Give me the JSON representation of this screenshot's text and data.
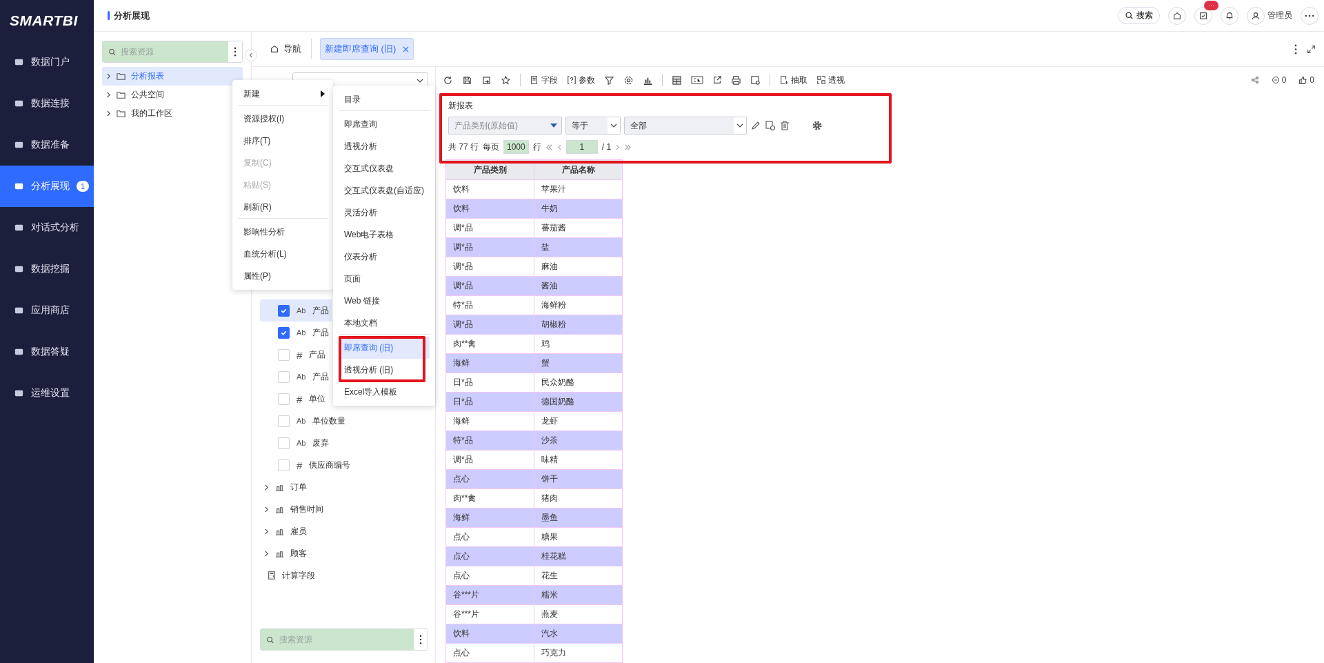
{
  "nav": {
    "logo": "SMARTBI",
    "items": [
      {
        "label": "数据门户",
        "selected": false
      },
      {
        "label": "数据连接",
        "selected": false
      },
      {
        "label": "数据准备",
        "selected": false
      },
      {
        "label": "分析展现",
        "selected": true,
        "badge": "1"
      },
      {
        "label": "对话式分析",
        "selected": false
      },
      {
        "label": "数据挖掘",
        "selected": false
      },
      {
        "label": "应用商店",
        "selected": false
      },
      {
        "label": "数据答疑",
        "selected": false
      },
      {
        "label": "运维设置",
        "selected": false
      }
    ]
  },
  "header": {
    "title": "分析展现",
    "search": "搜索",
    "task_badge": "···",
    "user": "管理员"
  },
  "resources": {
    "search_placeholder": "搜索资源",
    "items": [
      {
        "label": "分析报表",
        "selected": true
      },
      {
        "label": "公共空间",
        "selected": false
      },
      {
        "label": "我的工作区",
        "selected": false
      }
    ]
  },
  "tabs": [
    {
      "label": "导航",
      "selected": false
    },
    {
      "label": "新建即席查询 (旧)",
      "selected": true
    }
  ],
  "fields": {
    "items": [
      {
        "label": "产品",
        "kind": "text",
        "type_mark": "Ab",
        "checked": true,
        "selected": true
      },
      {
        "label": "产品",
        "kind": "text",
        "type_mark": "Ab",
        "checked": true,
        "selected": false
      },
      {
        "label": "产品",
        "kind": "number",
        "type_mark": "#",
        "checked": false,
        "selected": false
      },
      {
        "label": "产品",
        "kind": "text",
        "type_mark": "Ab",
        "checked": false,
        "selected": false
      },
      {
        "label": "单位",
        "kind": "number",
        "type_mark": "#",
        "checked": false,
        "selected": false
      },
      {
        "label": "单位数量",
        "kind": "text",
        "type_mark": "Ab",
        "checked": false,
        "selected": false
      },
      {
        "label": "废弃",
        "kind": "text",
        "type_mark": "Ab",
        "checked": false,
        "selected": false
      },
      {
        "label": "供应商编号",
        "kind": "number",
        "type_mark": "#",
        "checked": false,
        "selected": false
      }
    ],
    "groups": [
      "订单",
      "销售时间",
      "雇员",
      "顾客"
    ],
    "calc": "计算字段",
    "search_placeholder": "搜索资源"
  },
  "context_menu": [
    {
      "label": "新建",
      "disabled": false,
      "submenu": true,
      "divider_after": true
    },
    {
      "label": "资源授权(I)",
      "disabled": false
    },
    {
      "label": "排序(T)",
      "disabled": false
    },
    {
      "label": "复制(C)",
      "disabled": true
    },
    {
      "label": "粘贴(S)",
      "disabled": true
    },
    {
      "label": "刷新(R)",
      "disabled": false,
      "divider_after": true
    },
    {
      "label": "影响性分析",
      "disabled": false
    },
    {
      "label": "血统分析(L)",
      "disabled": false
    },
    {
      "label": "属性(P)",
      "disabled": false
    }
  ],
  "submenu": [
    {
      "label": "目录",
      "selected": false,
      "divider_after": true
    },
    {
      "label": "即席查询",
      "selected": false
    },
    {
      "label": "透视分析",
      "selected": false
    },
    {
      "label": "交互式仪表盘",
      "selected": false
    },
    {
      "label": "交互式仪表盘(自适应)",
      "selected": false
    },
    {
      "label": "灵活分析",
      "selected": false
    },
    {
      "label": "Web电子表格",
      "selected": false
    },
    {
      "label": "仪表分析",
      "selected": false
    },
    {
      "label": "页面",
      "selected": false
    },
    {
      "label": "Web 链接",
      "selected": false
    },
    {
      "label": "本地文档",
      "selected": false,
      "divider_after": true
    },
    {
      "label": "即席查询 (旧)",
      "selected": true
    },
    {
      "label": "透视分析 (旧)",
      "selected": false
    },
    {
      "label": "Excel导入模板",
      "selected": false
    }
  ],
  "toolbar": {
    "fields": "字段",
    "params": "参数",
    "extract": "抽取",
    "pivot": "透视",
    "comments": "0",
    "likes": "0"
  },
  "filter": {
    "title": "新报表",
    "field": "产品类别(原始值)",
    "operator": "等于",
    "value": "全部",
    "total": "共 77 行",
    "per_page": "每页",
    "page_size": "1000",
    "rows_unit": "行",
    "page": "1",
    "pages": "/ 1"
  },
  "table": {
    "columns": [
      "产品类别",
      "产品名称"
    ],
    "rows": [
      [
        "饮料",
        "苹果汁"
      ],
      [
        "饮料",
        "牛奶"
      ],
      [
        "调*品",
        "蕃茄酱"
      ],
      [
        "调*品",
        "盐"
      ],
      [
        "调*品",
        "麻油"
      ],
      [
        "调*品",
        "酱油"
      ],
      [
        "特*品",
        "海鲜粉"
      ],
      [
        "调*品",
        "胡椒粉"
      ],
      [
        "肉**禽",
        "鸡"
      ],
      [
        "海鲜",
        "蟹"
      ],
      [
        "日*品",
        "民众奶酪"
      ],
      [
        "日*品",
        "德国奶酪"
      ],
      [
        "海鲜",
        "龙虾"
      ],
      [
        "特*品",
        "沙茶"
      ],
      [
        "调*品",
        "味精"
      ],
      [
        "点心",
        "饼干"
      ],
      [
        "肉**禽",
        "猪肉"
      ],
      [
        "海鲜",
        "墨鱼"
      ],
      [
        "点心",
        "糖果"
      ],
      [
        "点心",
        "桂花糕"
      ],
      [
        "点心",
        "花生"
      ],
      [
        "谷***片",
        "糯米"
      ],
      [
        "谷***片",
        "燕麦"
      ],
      [
        "饮料",
        "汽水"
      ],
      [
        "点心",
        "巧克力"
      ]
    ]
  }
}
